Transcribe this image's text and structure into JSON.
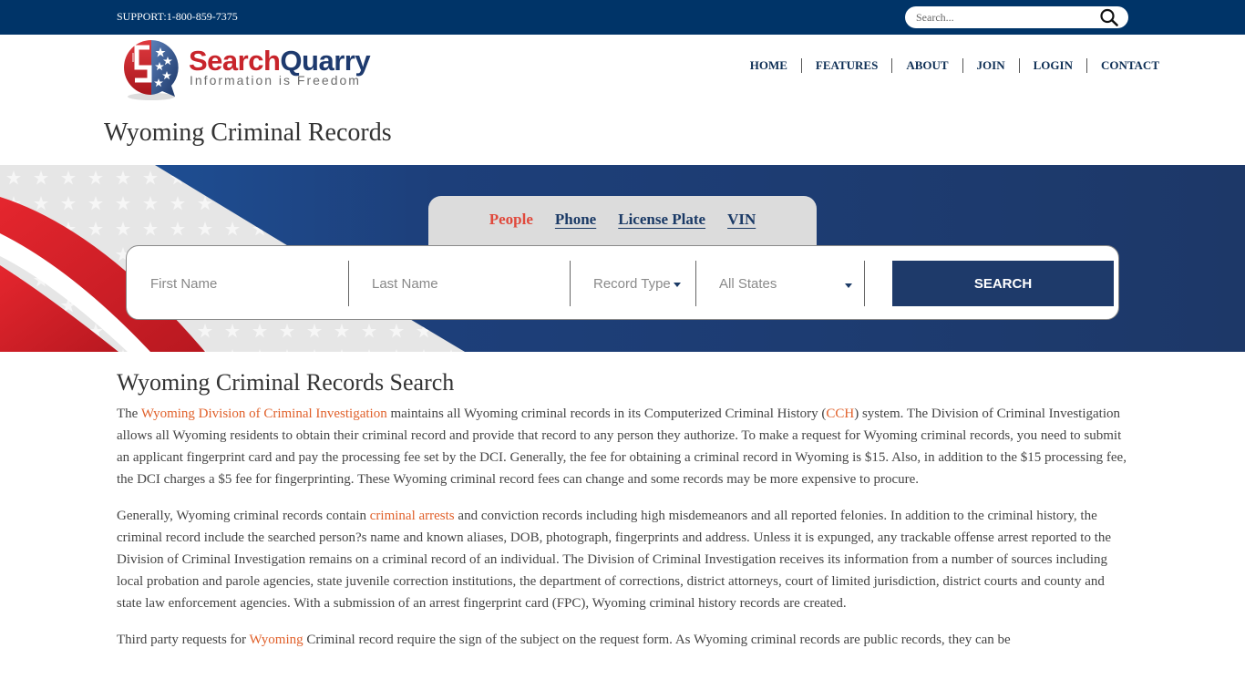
{
  "topbar": {
    "support_text": "SUPPORT:1-800-859-7375",
    "search_placeholder": "Search...",
    "search_icon": "magnifier-icon"
  },
  "logo": {
    "word_part1": "Search",
    "word_part2": "Quarry",
    "tagline": "Information is Freedom"
  },
  "nav": {
    "items": [
      {
        "label": "HOME"
      },
      {
        "label": "FEATURES"
      },
      {
        "label": "ABOUT"
      },
      {
        "label": "JOIN"
      },
      {
        "label": "LOGIN"
      },
      {
        "label": "CONTACT"
      }
    ]
  },
  "page_title": "Wyoming Criminal Records",
  "search": {
    "tabs": [
      {
        "label": "People",
        "active": true
      },
      {
        "label": "Phone",
        "active": false
      },
      {
        "label": "License Plate",
        "active": false
      },
      {
        "label": "VIN",
        "active": false
      }
    ],
    "first_name_placeholder": "First Name",
    "last_name_placeholder": "Last Name",
    "record_type_label": "Record Type",
    "state_label": "All States",
    "button_label": "SEARCH"
  },
  "colors": {
    "topbar_bg": "#003468",
    "brand_navy": "#1e3a6a",
    "brand_red": "#c8242b",
    "active_tab": "#e0493c",
    "link": "#e0602a"
  },
  "content": {
    "heading": "Wyoming Criminal Records Search",
    "p1": {
      "t1": "The ",
      "link1": "Wyoming Division of Criminal Investigation",
      "t2": " maintains all Wyoming criminal records in its Computerized Criminal History (",
      "link2": "CCH",
      "t3": ") system. The Division of Criminal Investigation allows all Wyoming residents to obtain their criminal record and provide that record to any person they authorize. To make a request for Wyoming criminal records, you need to submit an applicant fingerprint card and pay the processing fee set by the DCI. Generally, the fee for obtaining a criminal record in Wyoming is $15. Also, in addition to the $15 processing fee, the DCI charges a $5 fee for fingerprinting. These Wyoming criminal record fees can change and some records may be more expensive to procure."
    },
    "p2": {
      "t1": "Generally, Wyoming criminal records contain ",
      "link1": "criminal arrests",
      "t2": " and conviction records including high misdemeanors and all reported felonies. In addition to the criminal history, the criminal record include the searched person?s name and known aliases, DOB, photograph, fingerprints and address. Unless it is expunged, any trackable offense arrest reported to the Division of Criminal Investigation remains on a criminal record of an individual. The Division of Criminal Investigation receives its information from a number of sources including local probation and parole agencies, state juvenile correction institutions, the department of corrections, district attorneys, court of limited jurisdiction, district courts and county and state law enforcement agencies. With a submission of an arrest fingerprint card (FPC), Wyoming criminal history records are created."
    },
    "p3": {
      "t1": "Third party requests for ",
      "link1": "Wyoming",
      "t2": " Criminal record require the sign of the subject on the request form. As Wyoming criminal records are public records, they can be"
    }
  }
}
